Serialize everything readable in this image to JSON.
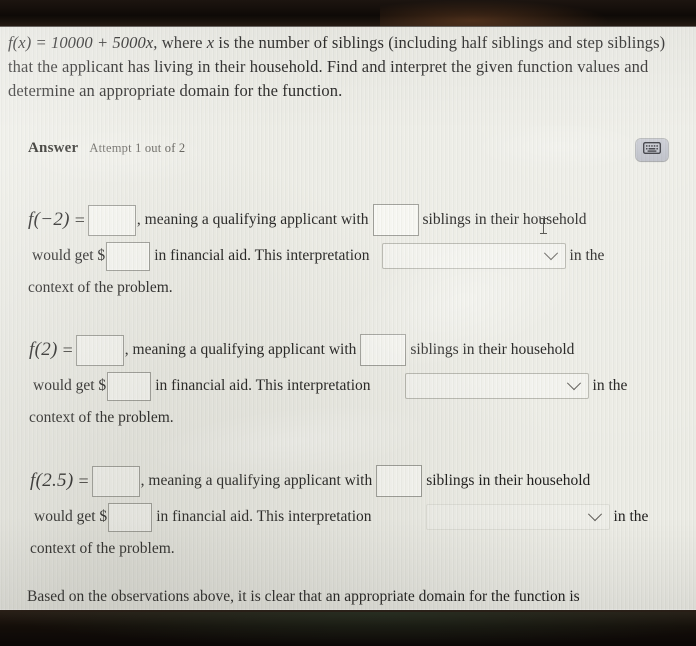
{
  "problem": {
    "function_formula": "f(x) = 10000 + 5000x",
    "text_before_var": ", where ",
    "variable": "x",
    "text_after": " is the number of siblings (including half siblings and step siblings) that the applicant has living in their household. Find and interpret the given function values and determine an appropriate domain for the function."
  },
  "answer_header": {
    "label": "Answer",
    "attempt": "Attempt 1 out of 2",
    "keyboard_button_name": "math-keyboard-icon"
  },
  "blocks": [
    {
      "expr": "f(−2)",
      "equals": "=",
      "value_field": "",
      "text_meaning": ", meaning a qualifying applicant with",
      "siblings_field": "",
      "text_siblings": "siblings in their household",
      "text_would_get": "would get $",
      "money_field": "",
      "text_aid": "in financial aid. This interpretation",
      "interpretation_select": "",
      "text_in_the": "in the",
      "text_context": "context of the problem."
    },
    {
      "expr": "f(2)",
      "equals": "=",
      "value_field": "",
      "text_meaning": ", meaning a qualifying applicant with",
      "siblings_field": "",
      "text_siblings": "siblings in their household",
      "text_would_get": "would get $",
      "money_field": "",
      "text_aid": "in financial aid. This interpretation",
      "interpretation_select": "",
      "text_in_the": "in the",
      "text_context": "context of the problem."
    },
    {
      "expr": "f(2.5)",
      "equals": "=",
      "value_field": "",
      "text_meaning": ", meaning a qualifying applicant with",
      "siblings_field": "",
      "text_siblings": "siblings in their household",
      "text_would_get": "would get $",
      "money_field": "",
      "text_aid": "in financial aid. This interpretation",
      "interpretation_select": "",
      "text_in_the": "in the",
      "text_context": "context of the problem."
    }
  ],
  "closing": {
    "text": "Based on the observations above, it is clear that an appropriate domain for the function is"
  },
  "colors": {
    "page_background": "#efefe9",
    "text": "#1e1d1c",
    "field_border": "#9d9d97",
    "select_border": "#b9b9b2",
    "bezel": "#17110c"
  }
}
